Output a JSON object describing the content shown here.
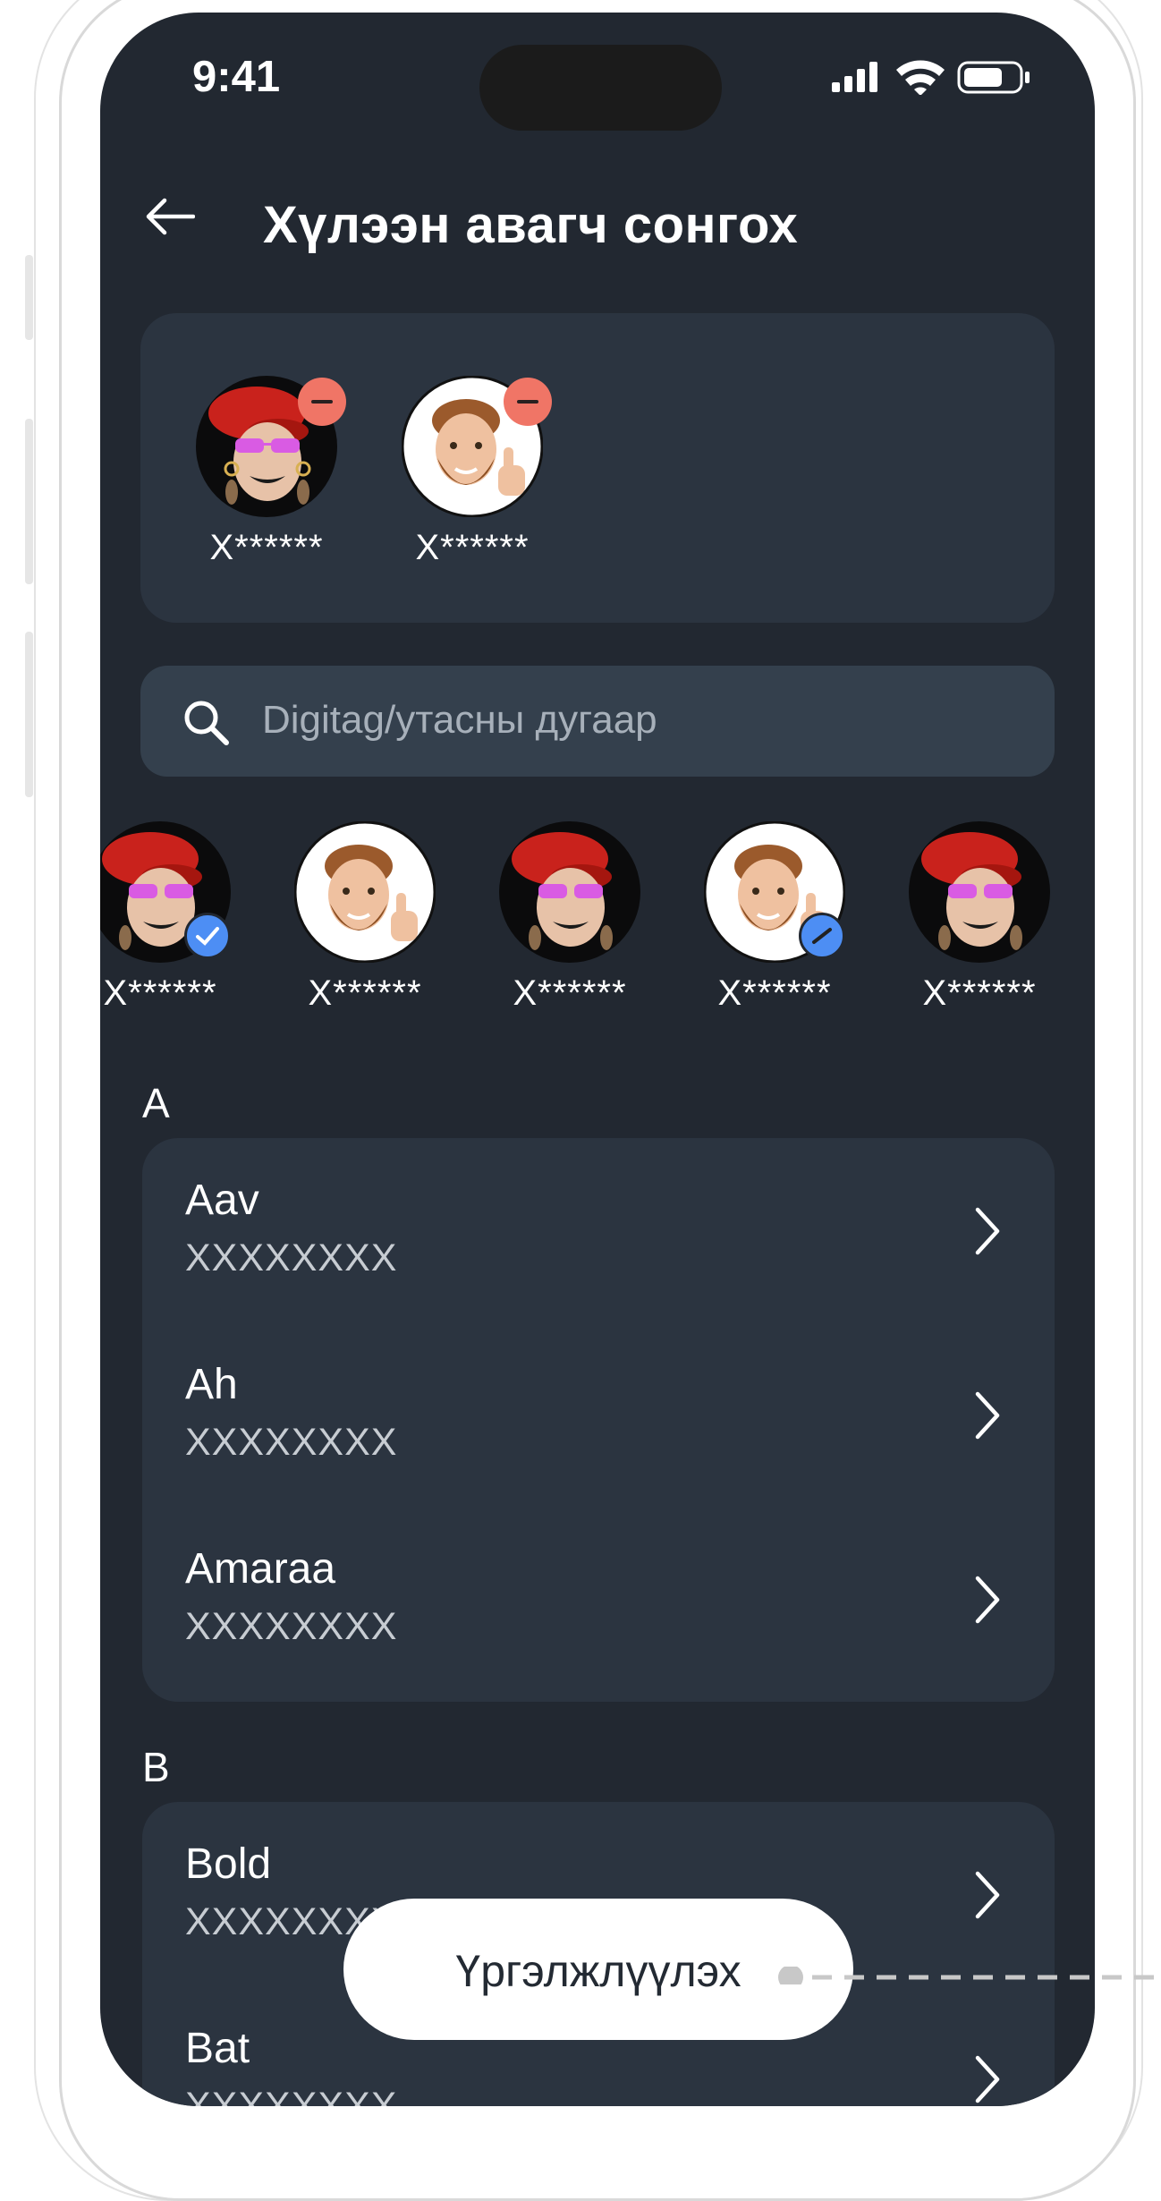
{
  "status_bar": {
    "time": "9:41"
  },
  "header": {
    "title": "Хүлээн авагч сонгох"
  },
  "selected": [
    {
      "name": "Х******",
      "avatar": "woman-memoji"
    },
    {
      "name": "Х******",
      "avatar": "man-memoji"
    }
  ],
  "search": {
    "placeholder": "Digitag/утасны дугаар"
  },
  "recent": [
    {
      "name": "Х******",
      "avatar": "woman-memoji",
      "checked": true
    },
    {
      "name": "Х******",
      "avatar": "man-memoji",
      "checked": false
    },
    {
      "name": "Х******",
      "avatar": "woman-memoji",
      "checked": false
    },
    {
      "name": "Х******",
      "avatar": "man-memoji",
      "checked": true
    },
    {
      "name": "Х******",
      "avatar": "woman-memoji",
      "checked": false
    }
  ],
  "contacts": {
    "sections": [
      {
        "letter": "A",
        "rows": [
          {
            "name": "Aav",
            "number": "XXXXXXXX"
          },
          {
            "name": "Ah",
            "number": "XXXXXXXX"
          },
          {
            "name": "Amaraa",
            "number": "XXXXXXXX"
          }
        ]
      },
      {
        "letter": "B",
        "rows": [
          {
            "name": "Bold",
            "number": "XXXXXXXX"
          },
          {
            "name": "Bat",
            "number": "XXXXXXXX"
          }
        ]
      }
    ]
  },
  "footer": {
    "continue_label": "Үргэлжлүүлэх"
  },
  "colors": {
    "background": "#222831",
    "card": "#2b3440",
    "search": "#34404d",
    "remove": "#f07566",
    "check": "#4d8ef4"
  }
}
